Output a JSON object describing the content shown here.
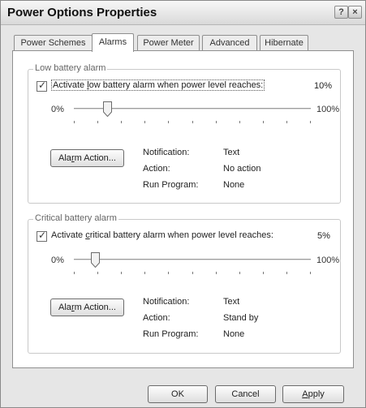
{
  "window": {
    "title": "Power Options Properties",
    "help_button": "?",
    "close_button": "×"
  },
  "tabs": [
    {
      "label": "Power Schemes",
      "active": false
    },
    {
      "label": "Alarms",
      "active": true
    },
    {
      "label": "Power Meter",
      "active": false
    },
    {
      "label": "Advanced",
      "active": false
    },
    {
      "label": "Hibernate",
      "active": false
    }
  ],
  "low_alarm": {
    "group_label": "Low battery alarm",
    "checkbox": {
      "pre": "Activate ",
      "accel": "l",
      "post": "ow battery alarm when power level reaches:",
      "checked": true
    },
    "level_text": "10%",
    "level": 10,
    "slider_min": "0%",
    "slider_max": "100%",
    "button": {
      "pre": "Ala",
      "accel": "r",
      "post": "m Action..."
    },
    "info": {
      "notification_label": "Notification:",
      "notification_value": "Text",
      "action_label": "Action:",
      "action_value": "No action",
      "run_program_label": "Run Program:",
      "run_program_value": "None"
    }
  },
  "critical_alarm": {
    "group_label": "Critical battery alarm",
    "checkbox": {
      "pre": "Activate ",
      "accel": "c",
      "post": "ritical battery alarm when power level reaches:",
      "checked": true
    },
    "level_text": "5%",
    "level": 5,
    "slider_min": "0%",
    "slider_max": "100%",
    "button": {
      "pre": "Ala",
      "accel": "r",
      "post": "m Action..."
    },
    "info": {
      "notification_label": "Notification:",
      "notification_value": "Text",
      "action_label": "Action:",
      "action_value": "Stand by",
      "run_program_label": "Run Program:",
      "run_program_value": "None"
    }
  },
  "footer": {
    "ok": "OK",
    "cancel": "Cancel",
    "apply": {
      "pre": "",
      "accel": "A",
      "post": "pply"
    }
  }
}
